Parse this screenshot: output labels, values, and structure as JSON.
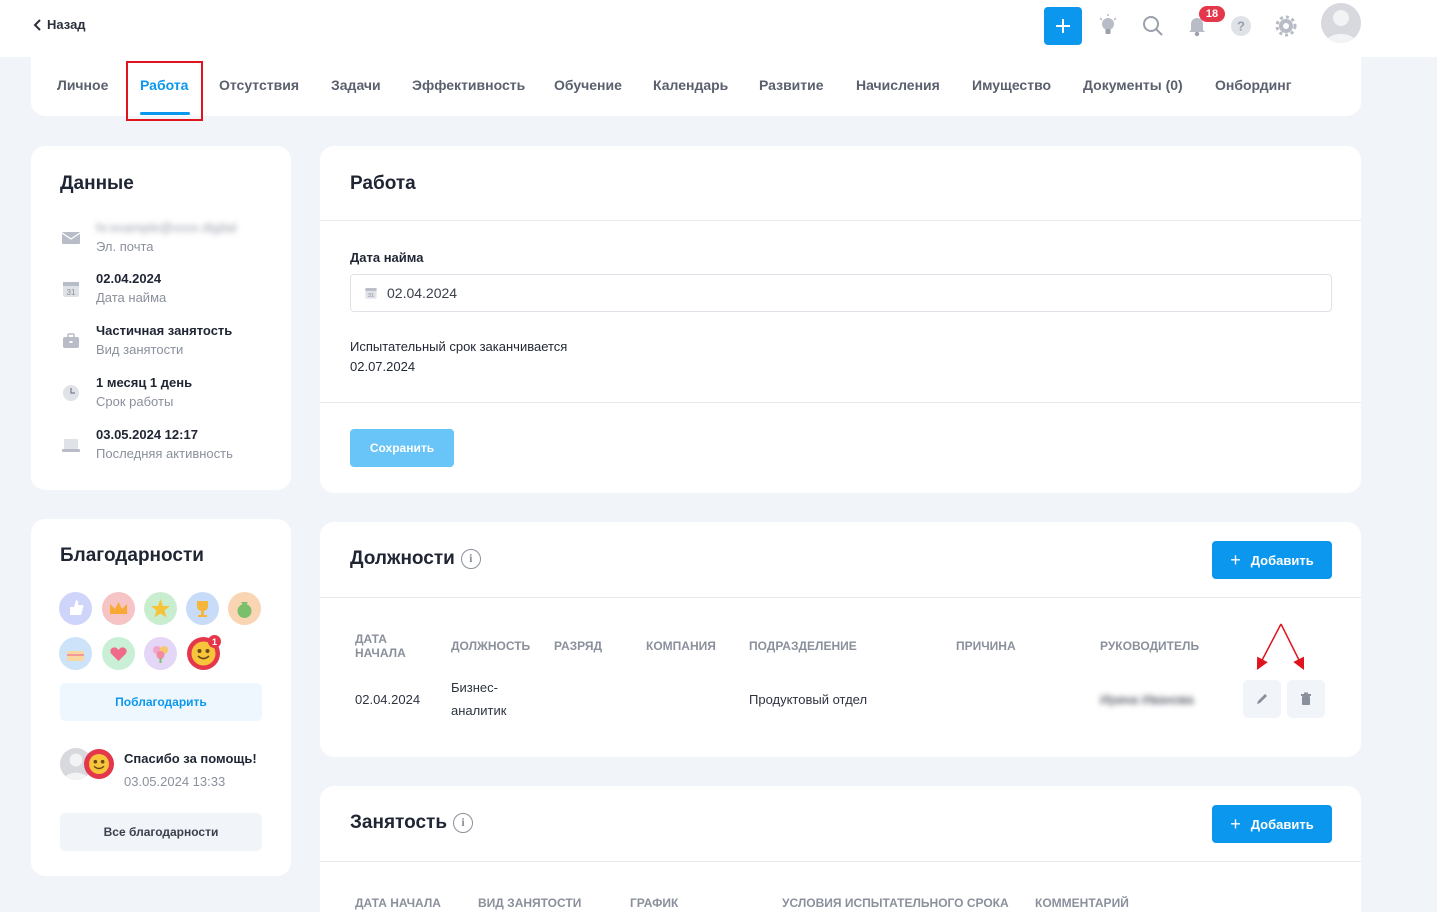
{
  "header": {
    "back_label": "Назад",
    "notifications_count": "18"
  },
  "tabs": [
    {
      "label": "Личное"
    },
    {
      "label": "Работа"
    },
    {
      "label": "Отсутствия"
    },
    {
      "label": "Задачи"
    },
    {
      "label": "Эффективность"
    },
    {
      "label": "Обучение"
    },
    {
      "label": "Календарь"
    },
    {
      "label": "Развитие"
    },
    {
      "label": "Начисления"
    },
    {
      "label": "Имущество"
    },
    {
      "label": "Документы (0)"
    },
    {
      "label": "Онбординг"
    }
  ],
  "data_card": {
    "title": "Данные",
    "email_sub": "Эл. почта",
    "hire_value": "02.04.2024",
    "hire_sub": "Дата найма",
    "employment_value": "Частичная занятость",
    "employment_sub": "Вид занятости",
    "tenure_value": "1 месяц 1 день",
    "tenure_sub": "Срок работы",
    "activity_value": "03.05.2024 12:17",
    "activity_sub": "Последняя активность"
  },
  "work": {
    "title": "Работа",
    "hire_date_label": "Дата найма",
    "hire_date_value": "02.04.2024",
    "probation_label": "Испытательный срок заканчивается",
    "probation_value": "02.07.2024",
    "save_label": "Сохранить"
  },
  "positions": {
    "title": "Должности",
    "add_label": "Добавить",
    "headers": {
      "start_line1": "ДАТА",
      "start_line2": "НАЧАЛА",
      "position": "ДОЛЖНОСТЬ",
      "grade": "РАЗРЯД",
      "company": "КОМПАНИЯ",
      "department": "ПОДРАЗДЕЛЕНИЕ",
      "reason": "ПРИЧИНА",
      "manager": "РУКОВОДИТЕЛЬ"
    },
    "rows": [
      {
        "start": "02.04.2024",
        "position_line1": "Бизнес-",
        "position_line2": "аналитик",
        "department": "Продуктовый отдел"
      }
    ]
  },
  "thanks": {
    "title": "Благодарности",
    "thank_button": "Поблагодарить",
    "badge_count": "1",
    "last_message": "Спасибо за помощь!",
    "last_date": "03.05.2024 13:33",
    "all_button": "Все благодарности"
  },
  "employment": {
    "title": "Занятость",
    "add_label": "Добавить",
    "headers": {
      "start": "ДАТА НАЧАЛА",
      "type": "ВИД ЗАНЯТОСТИ",
      "schedule": "ГРАФИК",
      "probation": "УСЛОВИЯ ИСПЫТАТЕЛЬНОГО СРОКА",
      "comment": "КОММЕНТАРИЙ"
    }
  },
  "colors": {
    "accent": "#0b97ee",
    "highlight_frame": "#e0141e",
    "badge": "#e5374c"
  }
}
